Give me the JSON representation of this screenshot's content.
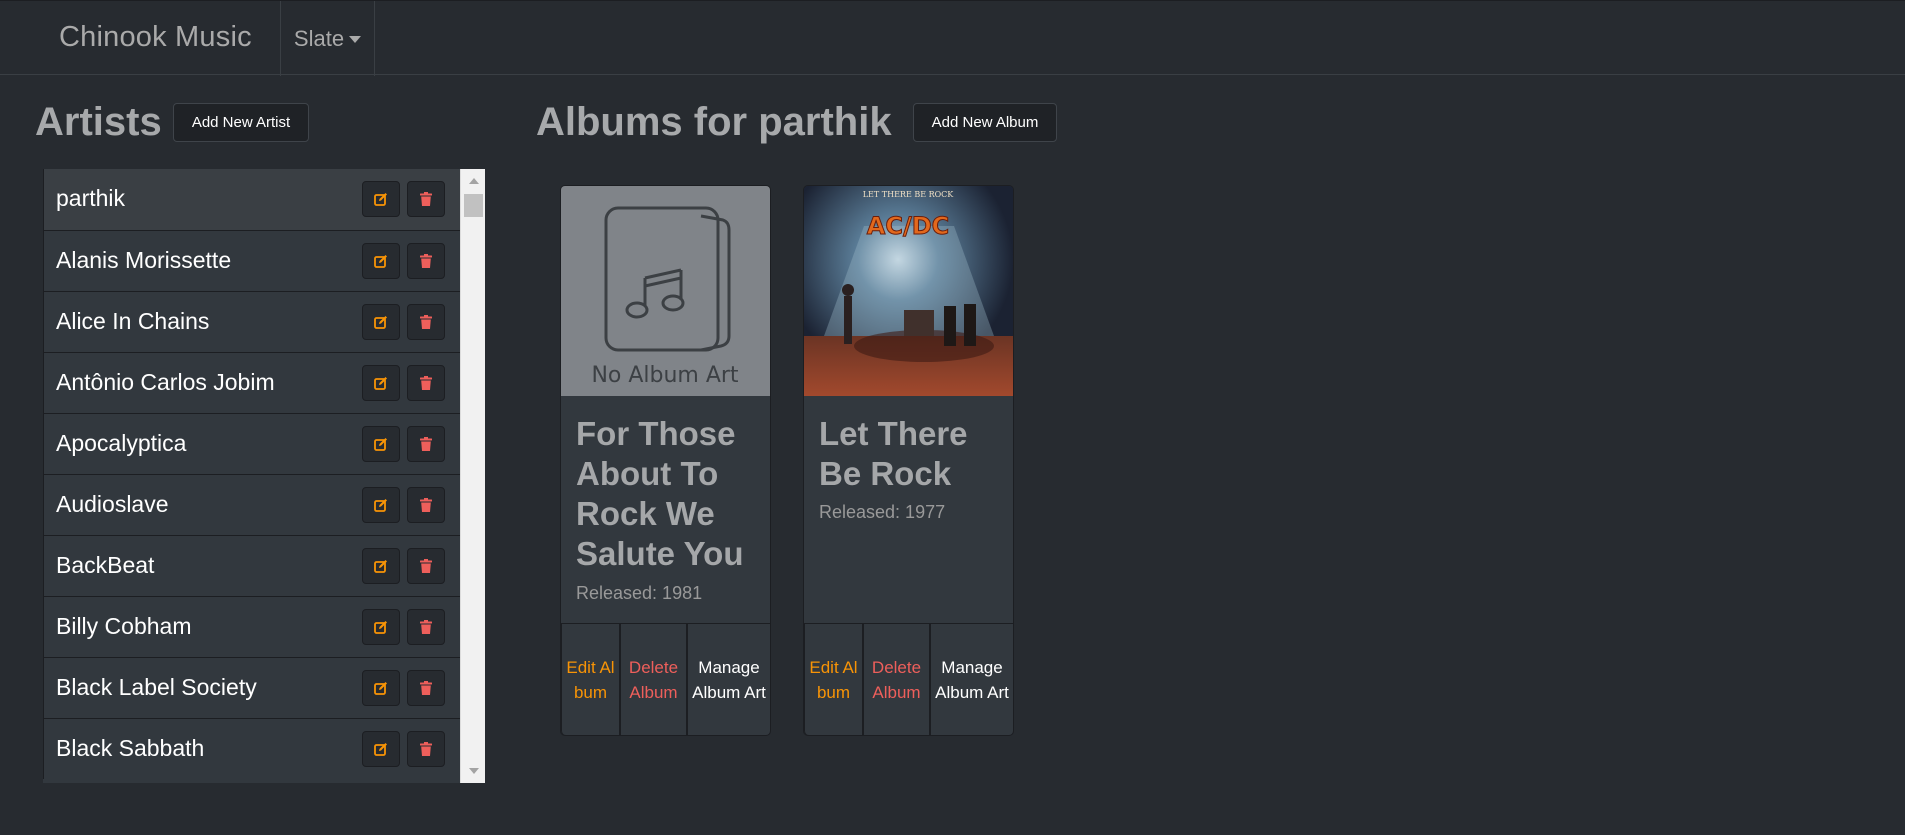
{
  "navbar": {
    "brand": "Chinook Music",
    "theme_label": "Slate"
  },
  "artists": {
    "heading": "Artists",
    "add_button": "Add New Artist",
    "items": [
      {
        "name": "parthik"
      },
      {
        "name": "Alanis Morissette"
      },
      {
        "name": "Alice In Chains"
      },
      {
        "name": "Antônio Carlos Jobim"
      },
      {
        "name": "Apocalyptica"
      },
      {
        "name": "Audioslave"
      },
      {
        "name": "BackBeat"
      },
      {
        "name": "Billy Cobham"
      },
      {
        "name": "Black Label Society"
      },
      {
        "name": "Black Sabbath"
      }
    ]
  },
  "albums": {
    "heading": "Albums for parthik",
    "add_button": "Add New Album",
    "cards": [
      {
        "title": "For Those About To Rock We Salute You",
        "released": "Released: 1981",
        "art_text": "No Album Art",
        "edit_label": "Edit Album",
        "delete_label": "Delete Album",
        "manage_label": "Manage Album Art"
      },
      {
        "title": "Let There Be Rock",
        "released": "Released: 1977",
        "art_top_text": "LET THERE BE ROCK",
        "art_logo_text": "AC/DC",
        "edit_label": "Edit Album",
        "delete_label": "Delete Album",
        "manage_label": "Manage Album Art"
      }
    ]
  },
  "colors": {
    "background": "#272b30",
    "edit_icon": "#f89406",
    "delete_icon": "#ee5f5b"
  },
  "icons": {
    "edit": "edit-icon",
    "delete": "trash-icon",
    "theme_caret": "caret-down-icon"
  }
}
